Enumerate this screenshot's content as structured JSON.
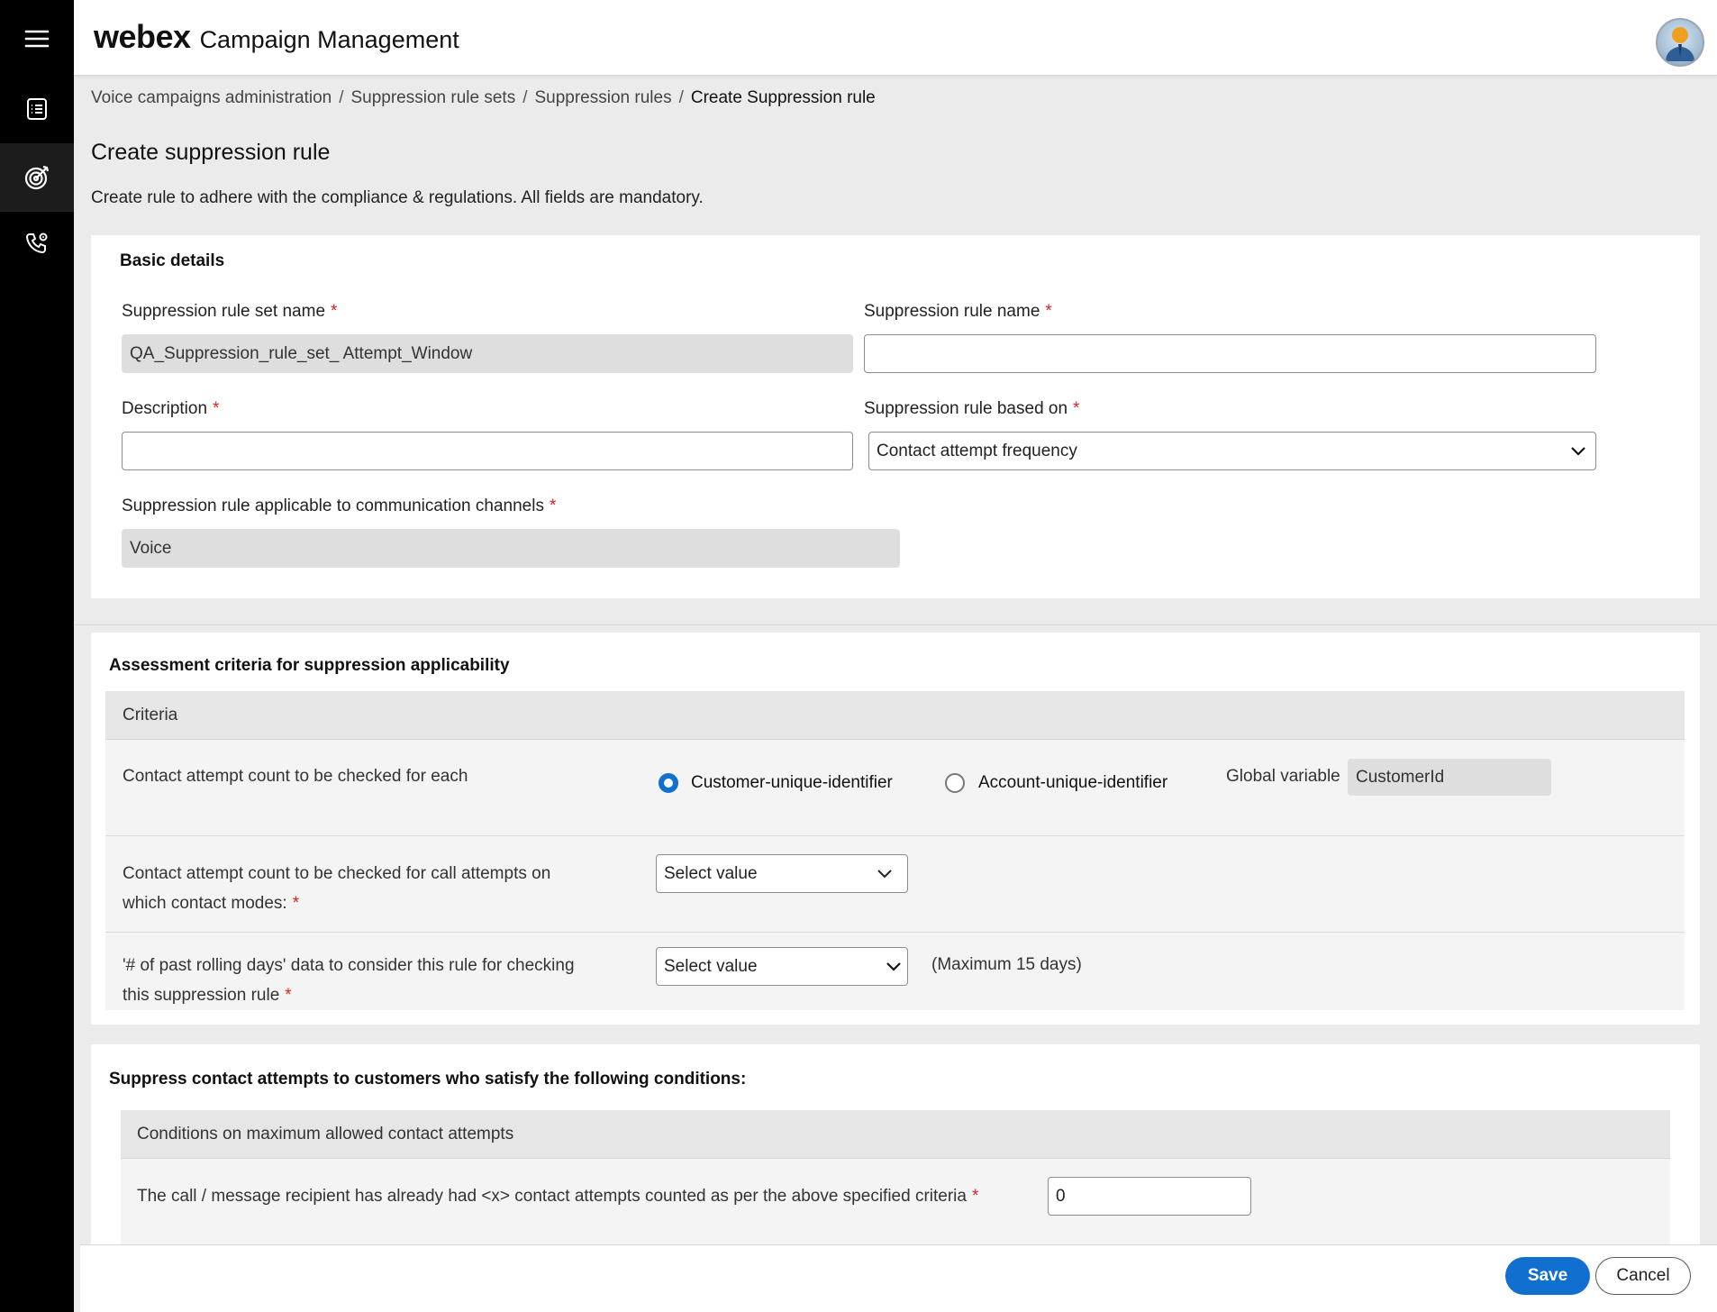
{
  "header": {
    "logo": "webex",
    "app_name": "Campaign Management"
  },
  "rail": {
    "items": [
      {
        "icon": "menu-icon"
      },
      {
        "icon": "list-icon"
      },
      {
        "icon": "target-icon",
        "active": true
      },
      {
        "icon": "phone-settings-icon"
      }
    ]
  },
  "breadcrumb": {
    "items": [
      "Voice campaigns administration",
      "Suppression rule sets",
      "Suppression rules"
    ],
    "separator": "/",
    "current": "Create Suppression rule"
  },
  "page": {
    "title": "Create suppression rule",
    "description": "Create rule to adhere with the compliance & regulations. All fields are mandatory."
  },
  "basic": {
    "title": "Basic details",
    "required_mark": "*",
    "rule_set_name_label": "Suppression rule set name",
    "rule_set_name_value": "QA_Suppression_rule_set_ Attempt_Window",
    "rule_name_label": "Suppression rule name",
    "rule_name_value": "",
    "description_label": "Description",
    "description_value": "",
    "based_on_label": "Suppression rule based on",
    "based_on_value": "Contact attempt frequency",
    "channels_label": "Suppression rule applicable to communication channels",
    "channels_value": "Voice"
  },
  "assessment": {
    "title": "Assessment criteria for suppression applicability",
    "table_header": "Criteria",
    "row1_label": "Contact attempt count to be checked for each",
    "radio1_label": "Customer-unique-identifier",
    "radio1_selected": true,
    "radio2_label": "Account-unique-identifier",
    "radio2_selected": false,
    "global_var_label": "Global variable",
    "global_var_value": "CustomerId",
    "row2_label_line1": "Contact attempt count to be checked for call attempts on",
    "row2_label_line2": "which contact modes:",
    "row2_select": "Select value",
    "row3_label_line1": "'# of past rolling days' data to consider this rule for checking",
    "row3_label_line2": "this suppression rule",
    "row3_select": "Select value",
    "row3_hint": "(Maximum 15 days)"
  },
  "conditions": {
    "title": "Suppress contact attempts to customers who satisfy the following conditions:",
    "table_header": "Conditions on maximum allowed contact attempts",
    "row1_label": "The call / message recipient has already had <x> contact attempts counted as per the above specified criteria",
    "row1_value": "0"
  },
  "footer": {
    "save_label": "Save",
    "cancel_label": "Cancel"
  },
  "colors": {
    "accent": "#1170cf",
    "required": "#dd2222",
    "rail": "#000000"
  }
}
